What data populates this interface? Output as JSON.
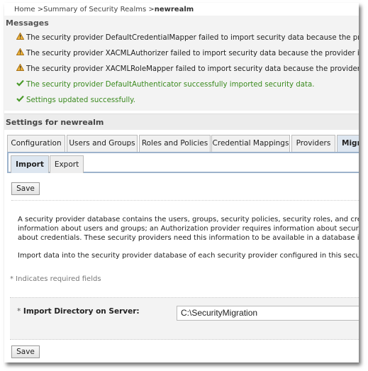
{
  "breadcrumb": {
    "home": "Home",
    "sep": " >",
    "realms": "Summary of Security Realms",
    "current": "newrealm"
  },
  "messages": {
    "title": "Messages",
    "items": [
      {
        "type": "warning",
        "icon": "warning-icon",
        "text": "The security provider DefaultCredentialMapper failed to import security data because the provider"
      },
      {
        "type": "warning",
        "icon": "warning-icon",
        "text": "The security provider XACMLAuthorizer failed to import security data because the provider is missi"
      },
      {
        "type": "warning",
        "icon": "warning-icon",
        "text": "The security provider XACMLRoleMapper failed to import security data because the provider is mis"
      },
      {
        "type": "success",
        "icon": "check-icon",
        "text": "The security provider DefaultAuthenticator successfully imported security data."
      },
      {
        "type": "success",
        "icon": "check-icon",
        "text": "Settings updated successfully."
      }
    ]
  },
  "settings": {
    "title": "Settings for newrealm"
  },
  "tabs": [
    "Configuration",
    "Users and Groups",
    "Roles and Policies",
    "Credential Mappings",
    "Providers",
    "Migration"
  ],
  "subtabs": [
    "Import",
    "Export"
  ],
  "save_label": "Save",
  "description": [
    "A security provider database contains the users, groups, security policies, security roles, and credentials",
    "information about users and groups; an Authorization provider requires information about security policies",
    "about credentials. These security providers need this information to be available in a database in order",
    "Import data into the security provider database of each security provider configured in this security realm"
  ],
  "required_note": "* Indicates required fields",
  "form": {
    "required_mark": "*",
    "label": "Import Directory on Server:",
    "value": "C:\\SecurityMigration"
  },
  "colors": {
    "success": "#3a8a1e",
    "tab_active": "#dde6f0",
    "accent_line": "#9db3cc"
  }
}
